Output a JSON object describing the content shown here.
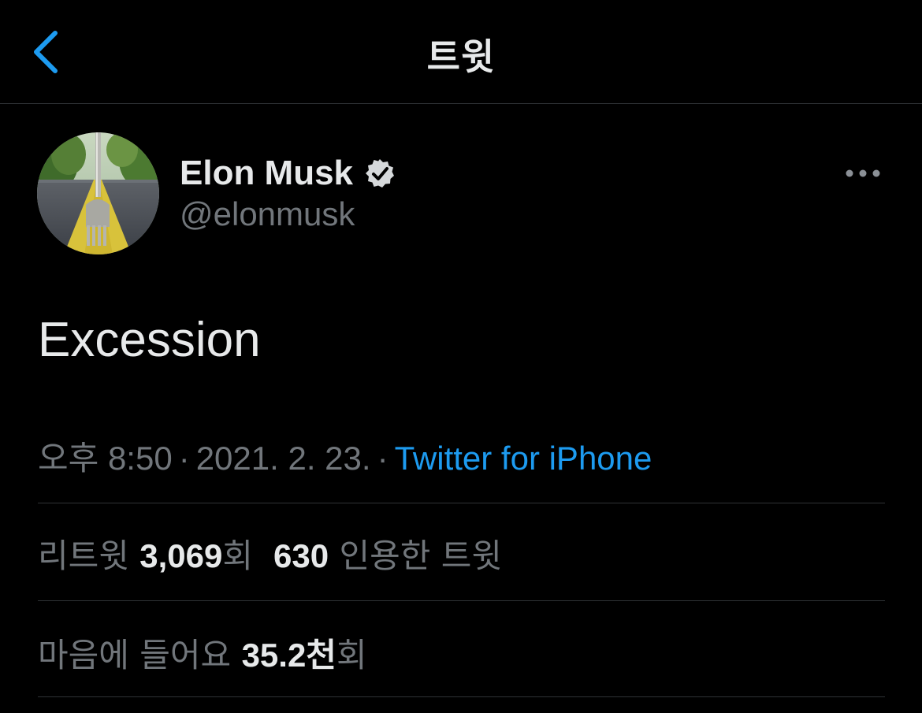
{
  "header": {
    "title": "트윗",
    "back_icon": "chevron-left-icon"
  },
  "colors": {
    "background": "#000000",
    "primary_text": "#e7e9ea",
    "secondary_text": "#71767b",
    "accent": "#1d9bf0",
    "divider": "#2f3336"
  },
  "tweet": {
    "author": {
      "name": "Elon Musk",
      "handle": "@elonmusk",
      "verified_icon": "verified-badge-icon",
      "avatar": "fork-in-road-avatar"
    },
    "more_icon": "more-dots-icon",
    "text": "Excession",
    "time": "오후 8:50",
    "separator": "·",
    "date": "2021. 2. 23.",
    "source": "Twitter for iPhone"
  },
  "stats": {
    "retweets_label": "리트윗",
    "retweets_count": "3,069",
    "retweets_unit": "회",
    "quotes_count": "630",
    "quotes_label": "인용한 트윗",
    "likes_label": "마음에 들어요",
    "likes_count": "35.2천",
    "likes_unit": "회"
  }
}
